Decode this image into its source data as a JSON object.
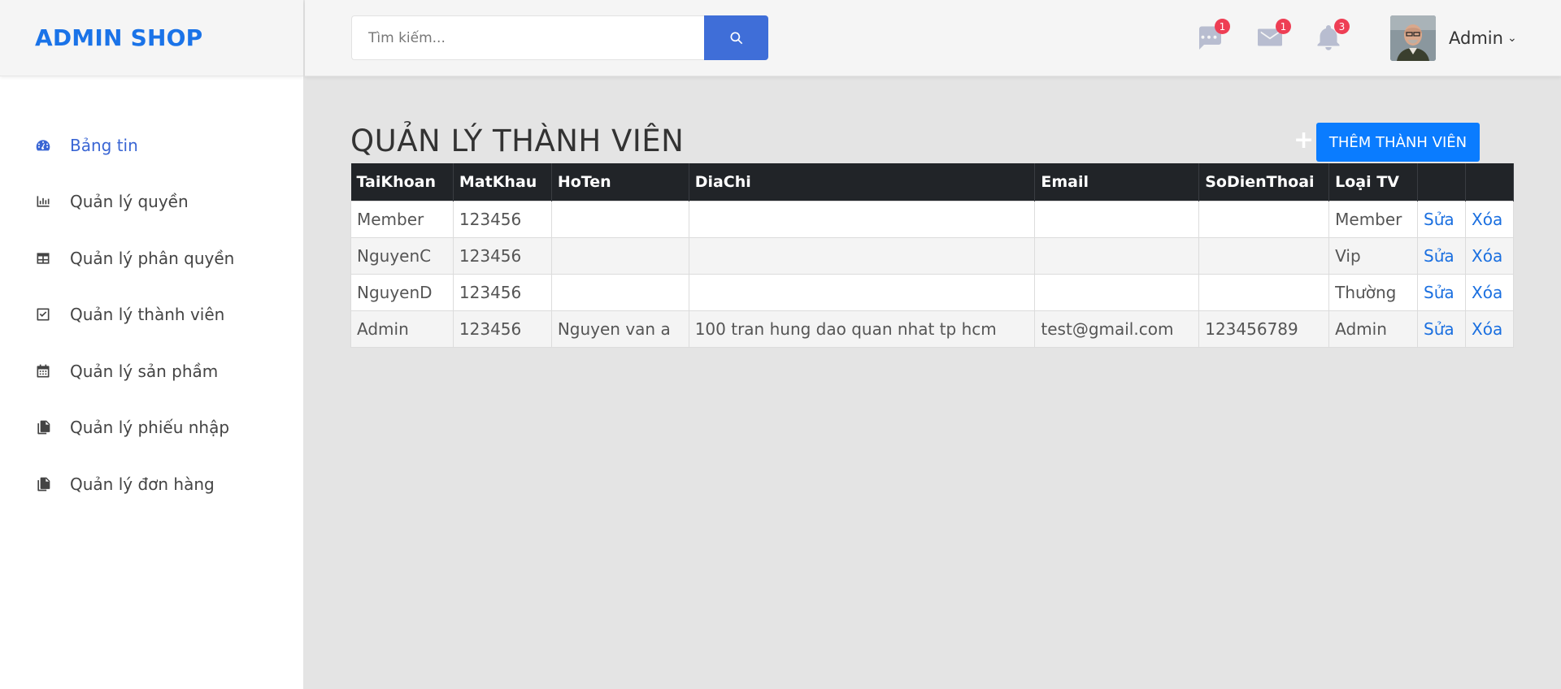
{
  "brand": "ADMIN SHOP",
  "sidebar": {
    "items": [
      {
        "label": "Bảng tin",
        "icon": "dashboard-icon",
        "active": true
      },
      {
        "label": "Quản lý quyền",
        "icon": "bar-chart-icon"
      },
      {
        "label": "Quản lý phân quyền",
        "icon": "table-icon"
      },
      {
        "label": "Quản lý thành viên",
        "icon": "check-square-icon"
      },
      {
        "label": "Quản lý sản phầm",
        "icon": "calendar-icon"
      },
      {
        "label": "Quản lý phiếu nhập",
        "icon": "copy-icon"
      },
      {
        "label": "Quản lý đơn hàng",
        "icon": "copy-icon"
      }
    ]
  },
  "header": {
    "search_placeholder": "Tìm kiếm...",
    "messages_badge": "1",
    "mail_badge": "1",
    "notifications_badge": "3",
    "user_name": "Admin",
    "caret": "⌄"
  },
  "main": {
    "title": "QUẢN LÝ THÀNH VIÊN",
    "plus": "+",
    "add_button": "THÊM THÀNH VIÊN",
    "columns": [
      "TaiKhoan",
      "MatKhau",
      "HoTen",
      "DiaChi",
      "Email",
      "SoDienThoai",
      "Loại TV",
      "",
      ""
    ],
    "rows": [
      {
        "TaiKhoan": "Member",
        "MatKhau": "123456",
        "HoTen": "",
        "DiaChi": "",
        "Email": "",
        "SoDienThoai": "",
        "LoaiTV": "Member",
        "edit": "Sửa",
        "delete": "Xóa"
      },
      {
        "TaiKhoan": "NguyenC",
        "MatKhau": "123456",
        "HoTen": "",
        "DiaChi": "",
        "Email": "",
        "SoDienThoai": "",
        "LoaiTV": "Vip",
        "edit": "Sửa",
        "delete": "Xóa"
      },
      {
        "TaiKhoan": "NguyenD",
        "MatKhau": "123456",
        "HoTen": "",
        "DiaChi": "",
        "Email": "",
        "SoDienThoai": "",
        "LoaiTV": "Thường",
        "edit": "Sửa",
        "delete": "Xóa"
      },
      {
        "TaiKhoan": "Admin",
        "MatKhau": "123456",
        "HoTen": "Nguyen van a",
        "DiaChi": "100 tran hung dao quan nhat tp hcm",
        "Email": "test@gmail.com",
        "SoDienThoai": "123456789",
        "LoaiTV": "Admin",
        "edit": "Sửa",
        "delete": "Xóa"
      }
    ]
  },
  "colors": {
    "brand": "#1a73e8",
    "primary_button": "#0a7cff",
    "search_button": "#3f6ed8",
    "badge": "#ee3e54",
    "table_header": "#212428"
  }
}
